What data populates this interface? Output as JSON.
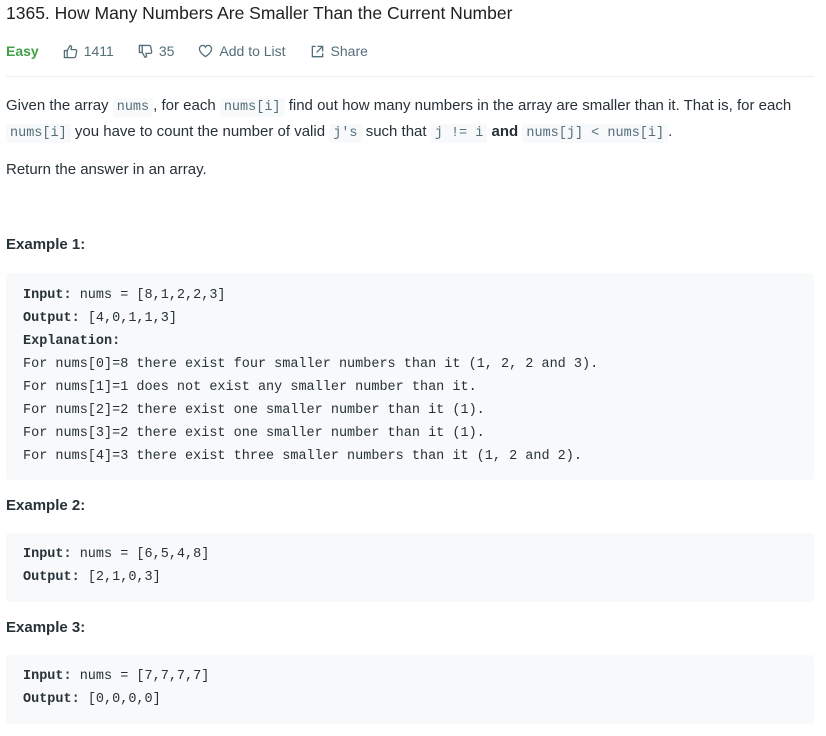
{
  "problem": {
    "title": "1365. How Many Numbers Are Smaller Than the Current Number",
    "difficulty": "Easy",
    "likes": "1411",
    "dislikes": "35",
    "add_to_list": "Add to List",
    "share": "Share"
  },
  "description": {
    "p1": {
      "t1": "Given the array ",
      "c1": "nums",
      "t2": ", for each ",
      "c2": "nums[i]",
      "t3": " find out how many numbers in the array are smaller than it. That is, for each ",
      "c3": "nums[i]",
      "t4": " you have to count the number of valid ",
      "c4": "j's",
      "t5": " such that ",
      "c5": "j != i",
      "t6": " ",
      "b1": "and",
      "t7": " ",
      "c6": "nums[j] < nums[i]",
      "t8": "."
    },
    "p2": "Return the answer in an array."
  },
  "examples": [
    {
      "heading": "Example 1:",
      "input_label": "Input:",
      "input_value": " nums = [8,1,2,2,3]",
      "output_label": "Output:",
      "output_value": " [4,0,1,1,3]",
      "explanation_label": "Explanation:",
      "explanation_lines": [
        "For nums[0]=8 there exist four smaller numbers than it (1, 2, 2 and 3).",
        "For nums[1]=1 does not exist any smaller number than it.",
        "For nums[2]=2 there exist one smaller number than it (1).",
        "For nums[3]=2 there exist one smaller number than it (1).",
        "For nums[4]=3 there exist three smaller numbers than it (1, 2 and 2)."
      ]
    },
    {
      "heading": "Example 2:",
      "input_label": "Input:",
      "input_value": " nums = [6,5,4,8]",
      "output_label": "Output:",
      "output_value": " [2,1,0,3]"
    },
    {
      "heading": "Example 3:",
      "input_label": "Input:",
      "input_value": " nums = [7,7,7,7]",
      "output_label": "Output:",
      "output_value": " [0,0,0,0]"
    }
  ],
  "colors": {
    "easy": "#43a047",
    "meta_text": "#546e7a",
    "code_bg": "#f7f9fa"
  }
}
